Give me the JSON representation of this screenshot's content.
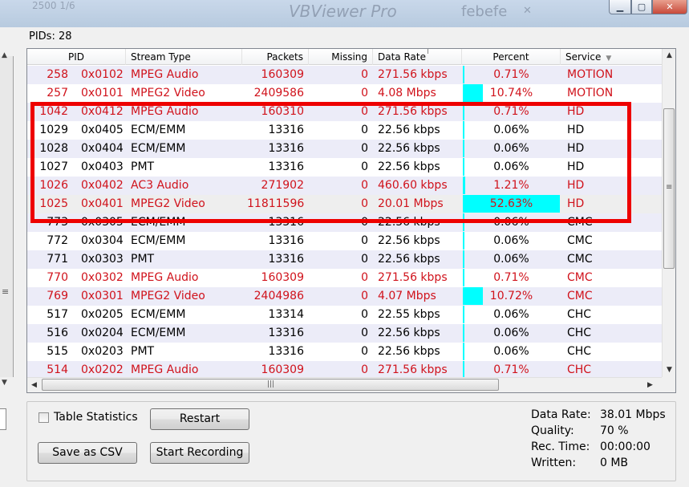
{
  "titlebar": {
    "ghost_left": "2500 1/6",
    "ghost_title": "VBViewer Pro",
    "ghost_tab": "febefe",
    "min_icon": "minimize-icon",
    "max_icon": "maximize-icon",
    "close_icon": "close-icon"
  },
  "pids_label": "PIDs: 28",
  "columns": {
    "pid": "PID",
    "type": "Stream Type",
    "packets": "Packets",
    "missing": "Missing",
    "rate": "Data Rate",
    "percent": "Percent",
    "service": "Service"
  },
  "rows": [
    {
      "dec": "258",
      "hex": "0x0102",
      "type": "MPEG Audio",
      "packets": "160309",
      "missing": "0",
      "rate": "271.56 kbps",
      "percent": "0.71%",
      "percent_value": 0.71,
      "service": "MOTION",
      "red": true
    },
    {
      "dec": "257",
      "hex": "0x0101",
      "type": "MPEG2 Video",
      "packets": "2409586",
      "missing": "0",
      "rate": "4.08 Mbps",
      "percent": "10.74%",
      "percent_value": 10.74,
      "service": "MOTION",
      "red": true
    },
    {
      "dec": "1042",
      "hex": "0x0412",
      "type": "MPEG Audio",
      "packets": "160310",
      "missing": "0",
      "rate": "271.56 kbps",
      "percent": "0.71%",
      "percent_value": 0.71,
      "service": "HD",
      "red": true
    },
    {
      "dec": "1029",
      "hex": "0x0405",
      "type": "ECM/EMM",
      "packets": "13316",
      "missing": "0",
      "rate": "22.56 kbps",
      "percent": "0.06%",
      "percent_value": 0.06,
      "service": "HD",
      "red": false
    },
    {
      "dec": "1028",
      "hex": "0x0404",
      "type": "ECM/EMM",
      "packets": "13316",
      "missing": "0",
      "rate": "22.56 kbps",
      "percent": "0.06%",
      "percent_value": 0.06,
      "service": "HD",
      "red": false
    },
    {
      "dec": "1027",
      "hex": "0x0403",
      "type": "PMT",
      "packets": "13316",
      "missing": "0",
      "rate": "22.56 kbps",
      "percent": "0.06%",
      "percent_value": 0.06,
      "service": "HD",
      "red": false
    },
    {
      "dec": "1026",
      "hex": "0x0402",
      "type": "AC3 Audio",
      "packets": "271902",
      "missing": "0",
      "rate": "460.60 kbps",
      "percent": "1.21%",
      "percent_value": 1.21,
      "service": "HD",
      "red": true
    },
    {
      "dec": "1025",
      "hex": "0x0401",
      "type": "MPEG2 Video",
      "packets": "11811596",
      "missing": "0",
      "rate": "20.01 Mbps",
      "percent": "52.63%",
      "percent_value": 52.63,
      "service": "HD",
      "red": true
    },
    {
      "dec": "773",
      "hex": "0x0305",
      "type": "ECM/EMM",
      "packets": "13316",
      "missing": "0",
      "rate": "22.56 kbps",
      "percent": "0.06%",
      "percent_value": 0.06,
      "service": "CMC",
      "red": false
    },
    {
      "dec": "772",
      "hex": "0x0304",
      "type": "ECM/EMM",
      "packets": "13316",
      "missing": "0",
      "rate": "22.56 kbps",
      "percent": "0.06%",
      "percent_value": 0.06,
      "service": "CMC",
      "red": false
    },
    {
      "dec": "771",
      "hex": "0x0303",
      "type": "PMT",
      "packets": "13316",
      "missing": "0",
      "rate": "22.56 kbps",
      "percent": "0.06%",
      "percent_value": 0.06,
      "service": "CMC",
      "red": false
    },
    {
      "dec": "770",
      "hex": "0x0302",
      "type": "MPEG Audio",
      "packets": "160309",
      "missing": "0",
      "rate": "271.56 kbps",
      "percent": "0.71%",
      "percent_value": 0.71,
      "service": "CMC",
      "red": true
    },
    {
      "dec": "769",
      "hex": "0x0301",
      "type": "MPEG2 Video",
      "packets": "2404986",
      "missing": "0",
      "rate": "4.07 Mbps",
      "percent": "10.72%",
      "percent_value": 10.72,
      "service": "CMC",
      "red": true
    },
    {
      "dec": "517",
      "hex": "0x0205",
      "type": "ECM/EMM",
      "packets": "13314",
      "missing": "0",
      "rate": "22.55 kbps",
      "percent": "0.06%",
      "percent_value": 0.06,
      "service": "CHC",
      "red": false
    },
    {
      "dec": "516",
      "hex": "0x0204",
      "type": "ECM/EMM",
      "packets": "13316",
      "missing": "0",
      "rate": "22.56 kbps",
      "percent": "0.06%",
      "percent_value": 0.06,
      "service": "CHC",
      "red": false
    },
    {
      "dec": "515",
      "hex": "0x0203",
      "type": "PMT",
      "packets": "13316",
      "missing": "0",
      "rate": "22.56 kbps",
      "percent": "0.06%",
      "percent_value": 0.06,
      "service": "CHC",
      "red": false
    },
    {
      "dec": "514",
      "hex": "0x0202",
      "type": "MPEG Audio",
      "packets": "160309",
      "missing": "0",
      "rate": "271.56 kbps",
      "percent": "0.71%",
      "percent_value": 0.71,
      "service": "CHC",
      "red": true
    }
  ],
  "controls": {
    "table_statistics": "Table Statistics",
    "restart": "Restart",
    "save_csv": "Save as CSV",
    "start_recording": "Start Recording"
  },
  "stats": {
    "data_rate_label": "Data Rate:",
    "data_rate_value": "38.01 Mbps",
    "quality_label": "Quality:",
    "quality_value": "70 %",
    "rec_time_label": "Rec. Time:",
    "rec_time_value": "00:00:00",
    "written_label": "Written:",
    "written_value": "0 MB"
  },
  "colors": {
    "red_text": "#d0121b",
    "percent_bar": "#00ffff",
    "highlight_box": "#ee0000",
    "alt_row": "#ececf8"
  }
}
